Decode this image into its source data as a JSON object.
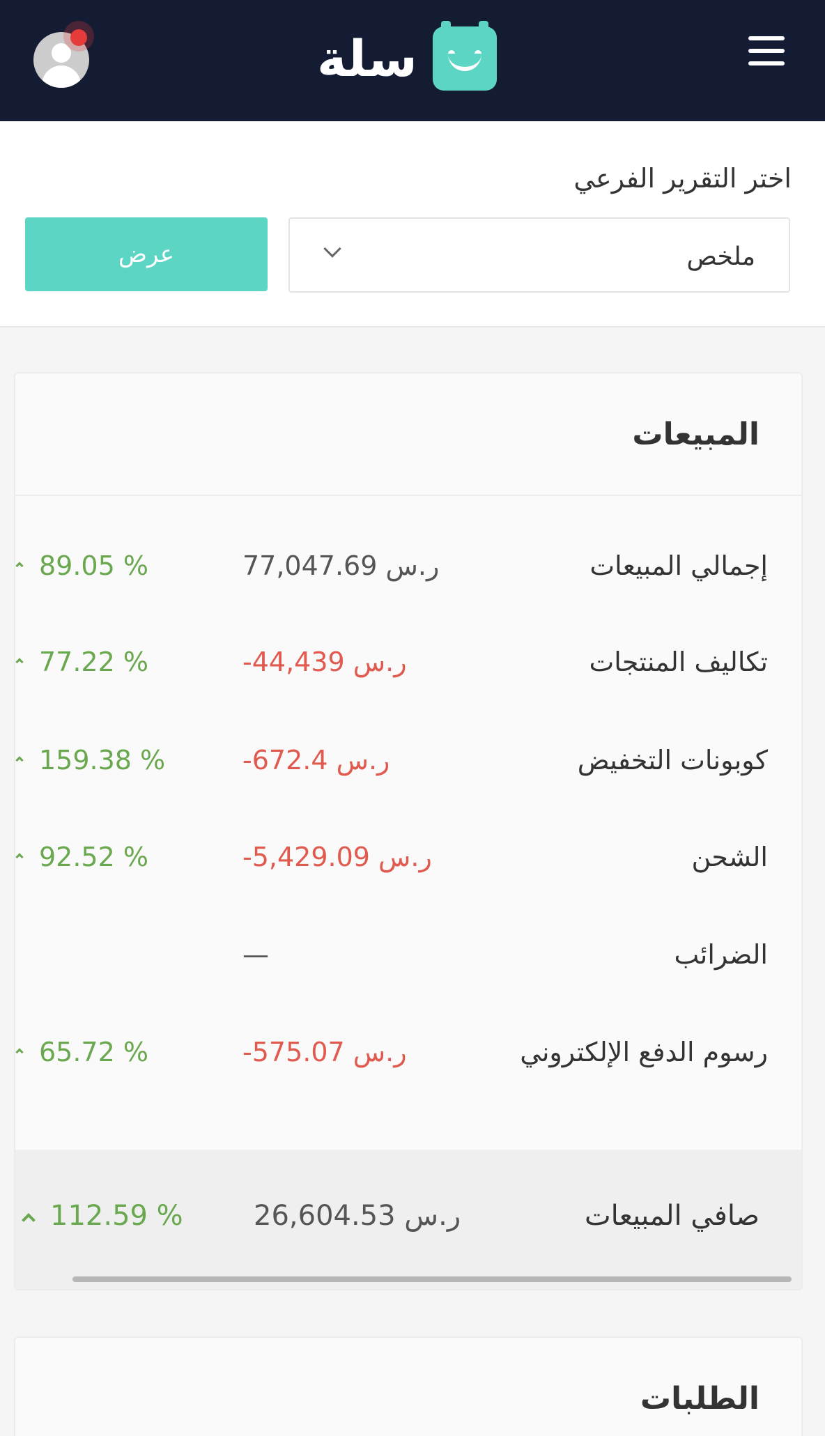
{
  "header": {
    "brand_name": "سلة",
    "menu_icon": "hamburger-menu-icon",
    "avatar_icon": "user-avatar-icon",
    "brand_color": "#5dd5c4",
    "header_bg": "#141c34",
    "notification_color": "#e63b3b"
  },
  "filter": {
    "label": "اختر التقرير الفرعي",
    "selected": "ملخص",
    "view_button": "عرض"
  },
  "sales": {
    "title": "المبيعات",
    "rows": [
      {
        "label": "إجمالي المبيعات",
        "value": "77,047.69 ر.س",
        "pct": "89.05 %",
        "value_status": "neutral"
      },
      {
        "label": "تكاليف المنتجات",
        "value": "-44,439 ر.س",
        "pct": "77.22 %",
        "value_status": "negative"
      },
      {
        "label": "كوبونات التخفيض",
        "value": "-672.4 ر.س",
        "pct": "159.38 %",
        "value_status": "negative"
      },
      {
        "label": "الشحن",
        "value": "-5,429.09 ر.س",
        "pct": "92.52 %",
        "value_status": "negative"
      },
      {
        "label": "الضرائب",
        "value": "—",
        "pct": "",
        "value_status": "neutral"
      },
      {
        "label": "رسوم الدفع الإلكتروني",
        "value": "-575.07 ر.س",
        "pct": "65.72 %",
        "value_status": "negative"
      }
    ],
    "net": {
      "label": "صافي المبيعات",
      "value": "26,604.53 ر.س",
      "pct": "112.59 %"
    }
  },
  "orders": {
    "title": "الطلبات"
  },
  "colors": {
    "positive": "#6aa84f",
    "negative": "#e05a4f",
    "accent": "#5dd5c4"
  }
}
